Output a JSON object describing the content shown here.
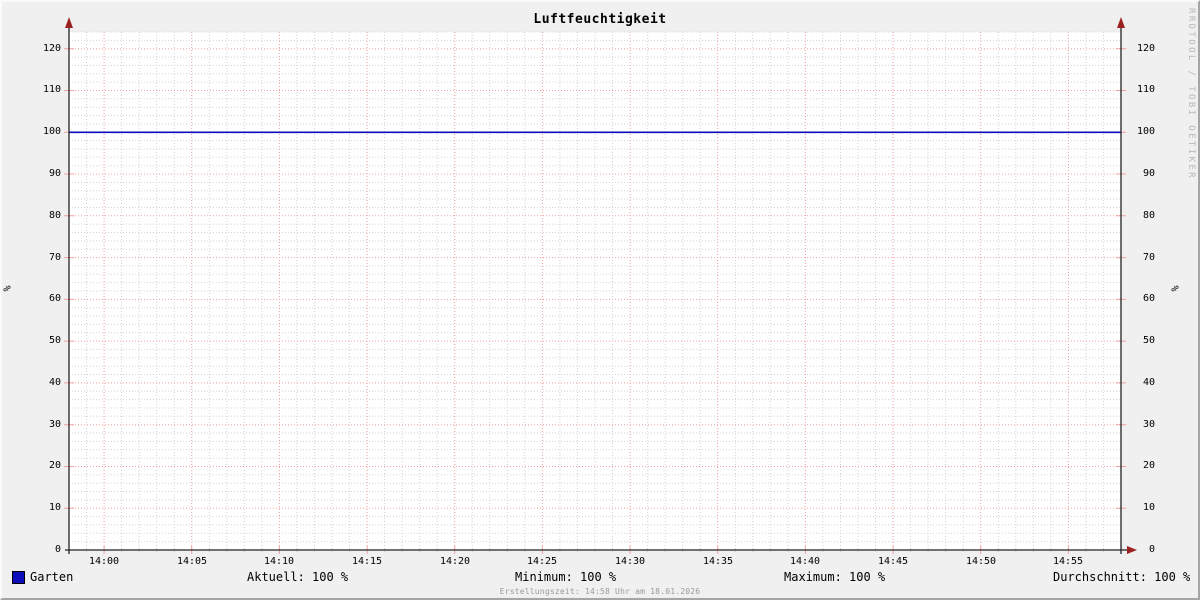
{
  "title": "Luftfeuchtigkeit",
  "watermark": "RRDTOOL / TOBI OETIKER",
  "footer": "Erstellungszeit: 14:58 Uhr am 18.01.2026",
  "y_axis": {
    "label": "%"
  },
  "legend": {
    "series_label": "Garten",
    "swatch_color": "#0d0dbb",
    "stats": {
      "aktuell": "Aktuell: 100 %",
      "minimum": "Minimum: 100 %",
      "maximum": "Maximum: 100 %",
      "durchschnitt": "Durchschnitt: 100 %"
    }
  },
  "chart_data": {
    "type": "line",
    "title": "Luftfeuchtigkeit",
    "xlabel": "",
    "ylabel": "%",
    "ylim": [
      0,
      124
    ],
    "y_major_step": 10,
    "y_minor_step": 2,
    "y_major_ticks": [
      0,
      10,
      20,
      30,
      40,
      50,
      60,
      70,
      80,
      90,
      100,
      110,
      120
    ],
    "x_range": [
      "13:58",
      "14:58"
    ],
    "x_major_ticks": [
      "14:00",
      "14:05",
      "14:10",
      "14:15",
      "14:20",
      "14:25",
      "14:30",
      "14:35",
      "14:40",
      "14:45",
      "14:50",
      "14:55"
    ],
    "x_minor_step_minutes": 1,
    "grid": {
      "on": true,
      "major_color": "#f0a0a0",
      "minor_color": "#d3d3d3"
    },
    "axis_color": "#222222",
    "arrow_color": "#9b2222",
    "canvas_color": "#ffffff",
    "legend_position": "bottom",
    "series": [
      {
        "name": "Garten",
        "color": "#0d0dbb",
        "x": [
          "13:58",
          "14:58"
        ],
        "values": [
          100,
          100
        ],
        "unit": "%",
        "stats": {
          "aktuell": 100,
          "minimum": 100,
          "maximum": 100,
          "durchschnitt": 100
        }
      }
    ]
  }
}
